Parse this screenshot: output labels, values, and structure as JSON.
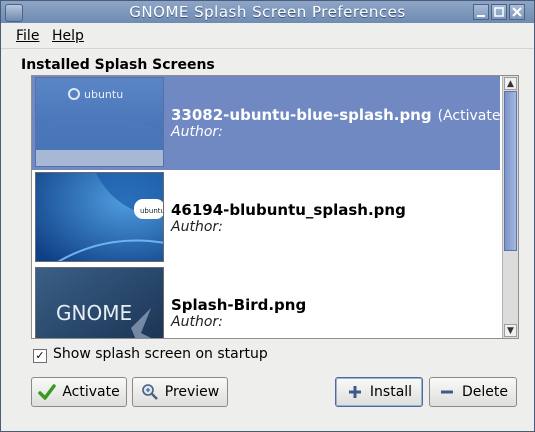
{
  "window": {
    "title": "GNOME Splash Screen Preferences"
  },
  "menubar": {
    "items": [
      {
        "label": "File"
      },
      {
        "label": "Help"
      }
    ]
  },
  "section_label": "Installed Splash Screens",
  "splash_list": [
    {
      "name": "33082-ubuntu-blue-splash.png",
      "status": "(Activated)",
      "author": "Author:",
      "thumb_text": "ubuntu"
    },
    {
      "name": "46194-blubuntu_splash.png",
      "status": "",
      "author": "Author:",
      "thumb_text": "ubuntu"
    },
    {
      "name": "Splash-Bird.png",
      "status": "",
      "author": "Author:",
      "thumb_text": "GNOME"
    }
  ],
  "show_on_startup": {
    "label": "Show splash screen on startup",
    "checked": true
  },
  "buttons": {
    "activate": "Activate",
    "preview": "Preview",
    "install": "Install",
    "delete": "Delete"
  },
  "colors": {
    "selection": "#7189c2",
    "titlebar": "#7a94b9"
  }
}
